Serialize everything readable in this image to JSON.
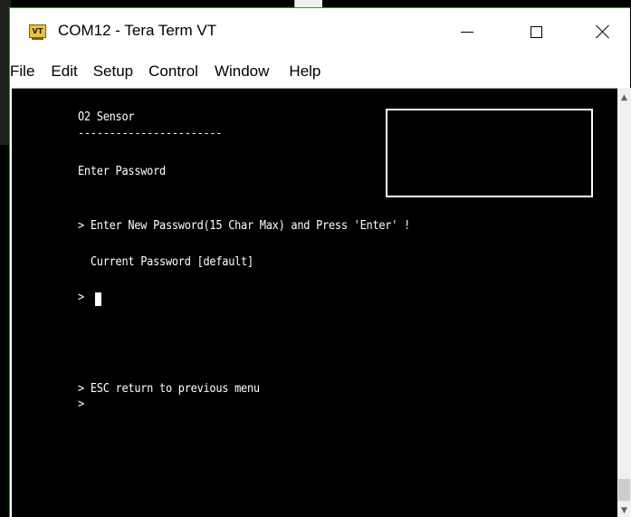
{
  "window": {
    "title": "COM12 - Tera Term VT",
    "icon_text": "VT",
    "icon_name": "tera-term-app-icon",
    "controls": {
      "minimize_icon": "minimize-icon",
      "maximize_icon": "maximize-icon",
      "close_icon": "close-icon"
    }
  },
  "menubar": {
    "items": [
      "File",
      "Edit",
      "Setup",
      "Control",
      "Window",
      "Help"
    ]
  },
  "terminal": {
    "foreground": "#ffffff",
    "background": "#000000",
    "lines": [
      "O2 Sensor",
      "-----------------------",
      "Enter Password",
      "> Enter New Password(15 Char Max) and Press 'Enter' !",
      "  Current Password [default]",
      "> ",
      "> ESC return to previous menu",
      ">"
    ]
  },
  "scrollbar": {
    "up_icon": "scroll-up-arrow-icon",
    "down_icon": "scroll-down-arrow-icon"
  }
}
